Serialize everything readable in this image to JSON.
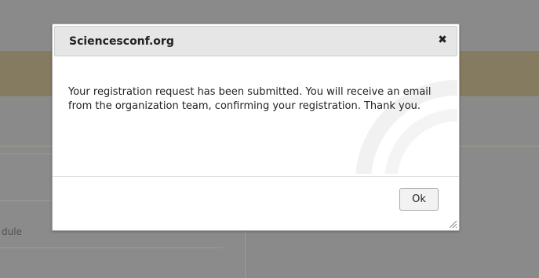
{
  "background": {
    "module_text": "dule"
  },
  "dialog": {
    "title": "Sciencesconf.org",
    "close_label": "✖",
    "message": "Your registration request has been submitted. You will receive an email from the organization team, confirming your registration. Thank you.",
    "ok_label": "Ok"
  },
  "colors": {
    "overlay": "#8a8a8a",
    "gold_band": "#857b60",
    "titlebar": "#e6e6e6",
    "dialog_bg": "#ffffff"
  }
}
